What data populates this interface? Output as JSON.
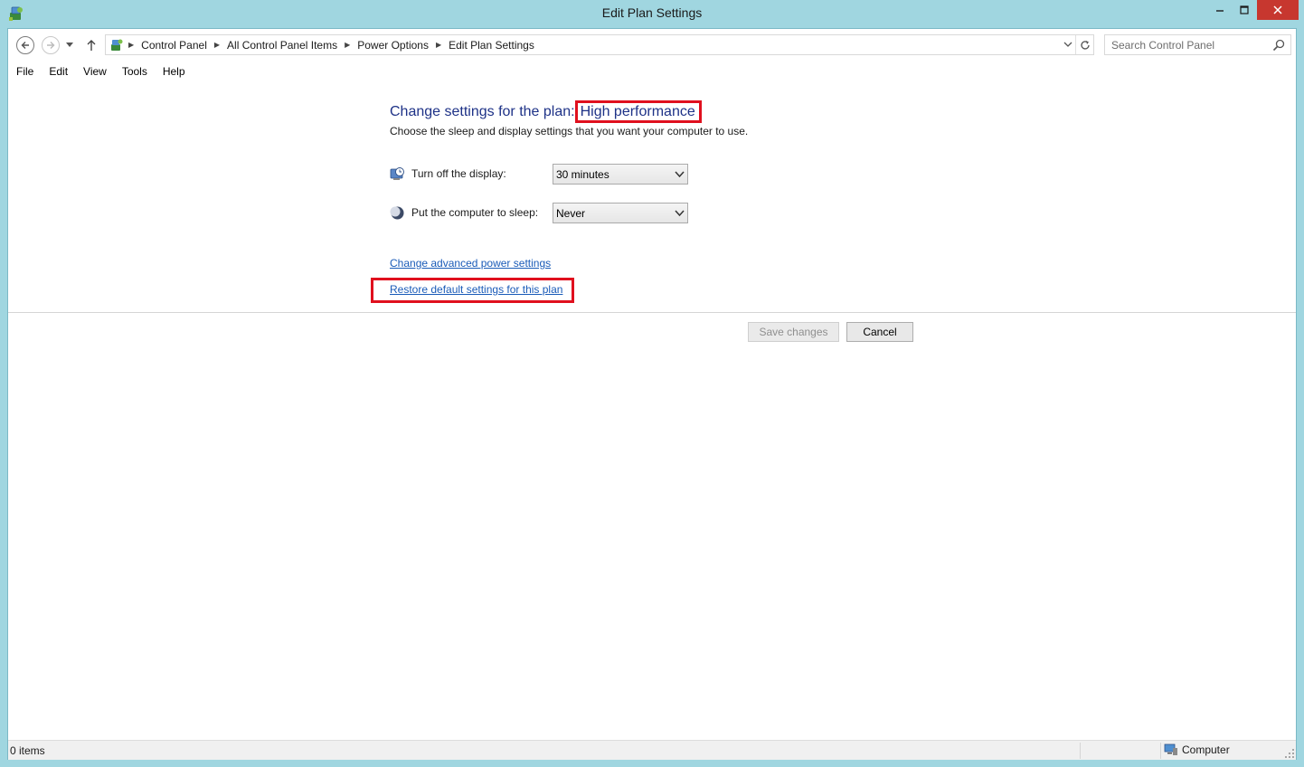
{
  "window": {
    "title": "Edit Plan Settings",
    "app_icon": "power-options-icon",
    "controls": {
      "minimize": "–",
      "maximize": "□",
      "close": "✕"
    }
  },
  "navigation": {
    "back_icon": "back-arrow-icon",
    "forward_icon": "forward-arrow-icon",
    "recent_icon": "chevron-down-icon",
    "up_icon": "up-arrow-icon",
    "breadcrumbs": [
      "Control Panel",
      "All Control Panel Items",
      "Power Options",
      "Edit Plan Settings"
    ],
    "search_placeholder": "Search Control Panel"
  },
  "menu": [
    "File",
    "Edit",
    "View",
    "Tools",
    "Help"
  ],
  "main": {
    "heading_prefix": "Change settings for the plan:",
    "plan_name": "High performance",
    "subtitle": "Choose the sleep and display settings that you want your computer to use.",
    "settings": [
      {
        "label": "Turn off the display:",
        "value": "30 minutes",
        "icon": "display-timer-icon"
      },
      {
        "label": "Put the computer to sleep:",
        "value": "Never",
        "icon": "sleep-moon-icon"
      }
    ],
    "advanced_link": "Change advanced power settings",
    "restore_link": "Restore default settings for this plan",
    "save_button": "Save changes",
    "cancel_button": "Cancel"
  },
  "statusbar": {
    "items": "0 items",
    "location": "Computer",
    "location_icon": "computer-icon"
  },
  "colors": {
    "frame": "#a0d6e0",
    "heading": "#1e3287",
    "link": "#1a5bb8",
    "highlight": "#e0101e",
    "close": "#c7372f"
  }
}
